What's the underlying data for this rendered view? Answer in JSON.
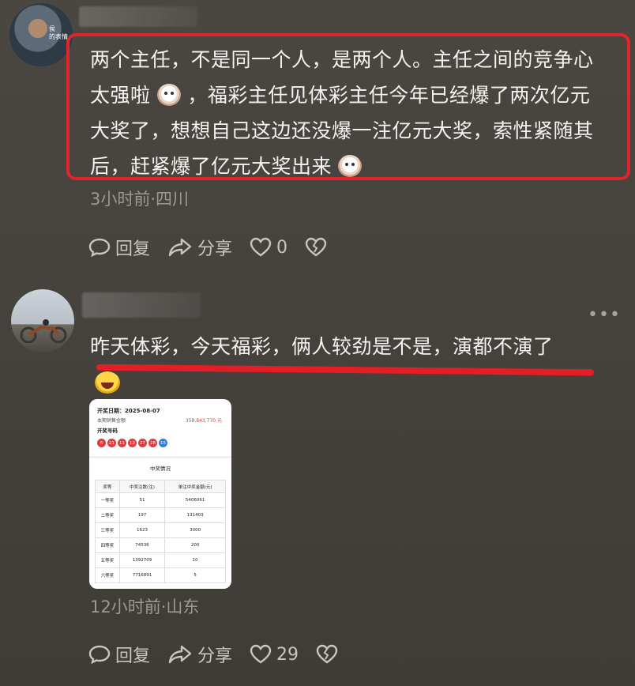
{
  "comments": [
    {
      "avatar_text": "侯\n的表情",
      "text_lines": [
        "两个主任，不是同一个人，是两个人。主任之间的竞争心",
        "太强啦",
        "，福彩主任见体彩主任今年已经爆了两次亿元",
        "大奖了，想想自己这边还没爆一注亿元大奖，索性紧随其",
        "后，赶紧爆了亿元大奖出来"
      ],
      "meta": "3小时前·四川",
      "actions": {
        "reply": "回复",
        "share": "分享",
        "likes": "0"
      }
    },
    {
      "text": "昨天体彩，今天福彩，俩人较劲是不是，演都不演了",
      "meta": "12小时前·山东",
      "actions": {
        "reply": "回复",
        "share": "分享",
        "likes": "29"
      },
      "more": "•••"
    }
  ],
  "lottery_card": {
    "date_label": "开奖日期：2025-08-07",
    "sales_label": "本期销售金额",
    "sales_value": "358,843,770 元",
    "numbers_label": "开奖号码",
    "red_balls": [
      "6",
      "21",
      "11",
      "12",
      "27",
      "28"
    ],
    "blue_ball": "15",
    "section_title": "中奖情况",
    "headers": [
      "奖等",
      "中奖注数(注)",
      "单注中奖金额(元)"
    ],
    "rows": [
      [
        "一等奖",
        "51",
        "5406061"
      ],
      [
        "二等奖",
        "197",
        "131403"
      ],
      [
        "三等奖",
        "1623",
        "3000"
      ],
      [
        "四等奖",
        "74536",
        "200"
      ],
      [
        "五等奖",
        "1392709",
        "10"
      ],
      [
        "六等奖",
        "7716891",
        "5"
      ]
    ]
  },
  "colors": {
    "highlight_red": "#e0262b",
    "red_ball": "#e23b3b",
    "blue_ball": "#2f7fe0"
  }
}
